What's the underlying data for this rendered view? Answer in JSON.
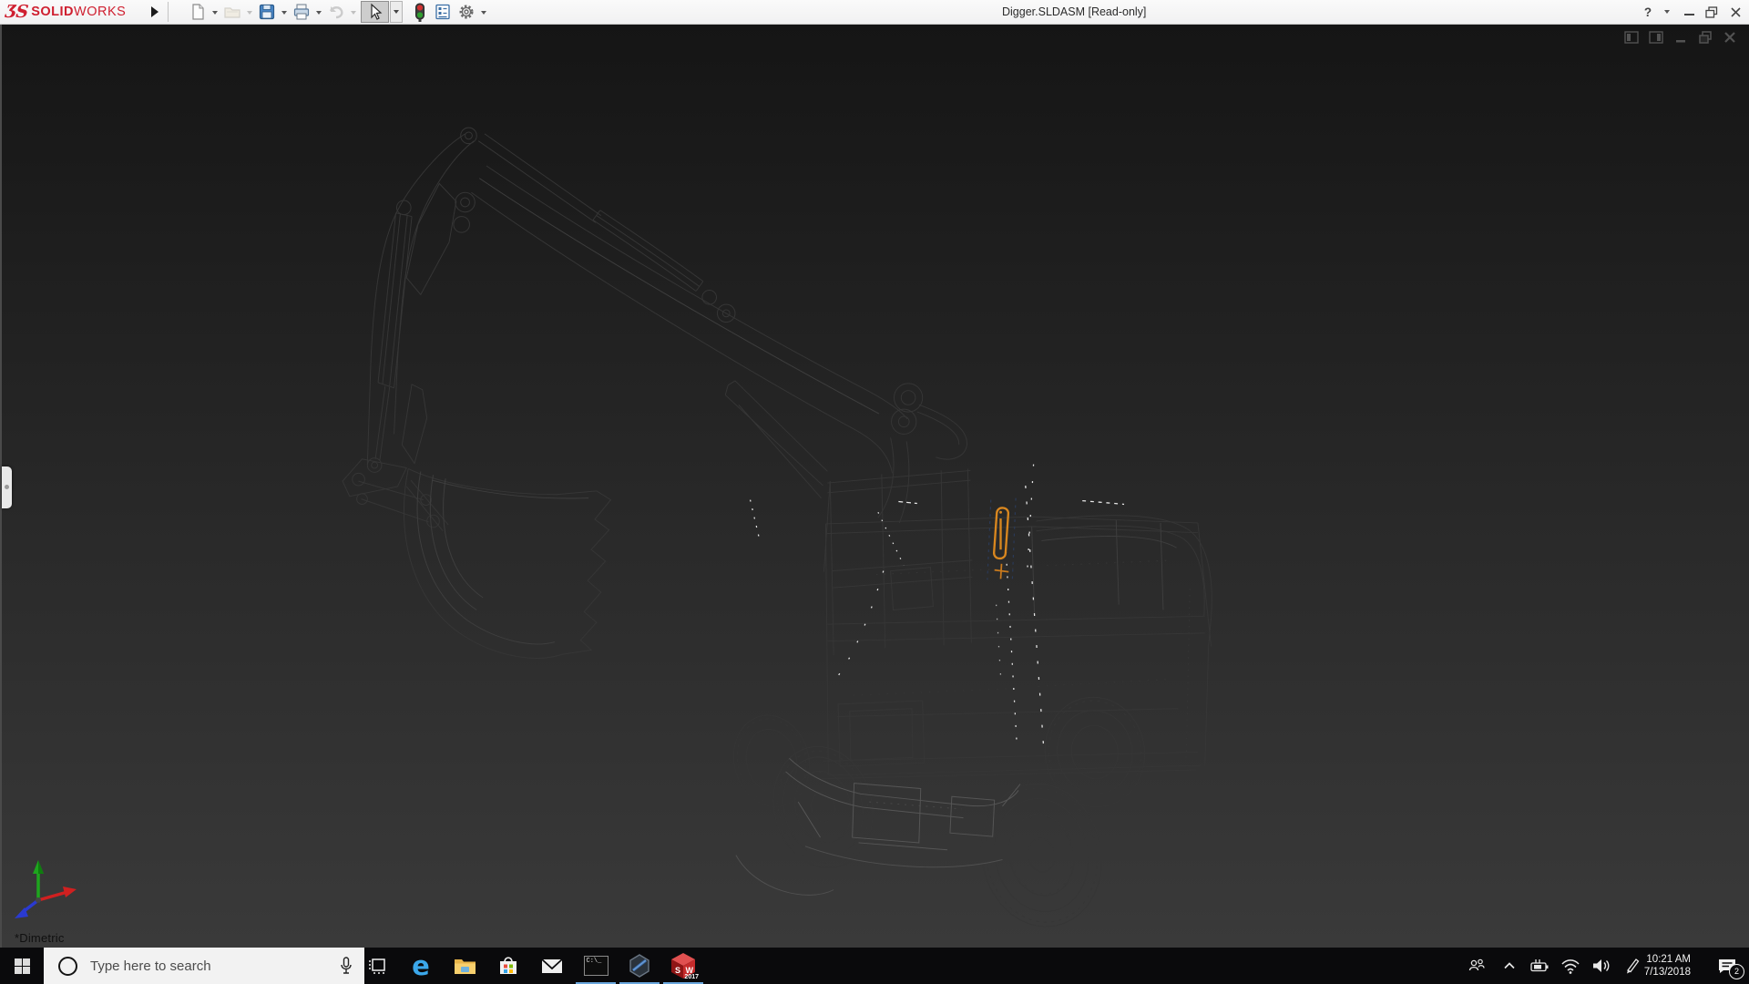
{
  "window": {
    "document_title": "Digger.SLDASM [Read-only]",
    "help_glyph": "?",
    "controls": [
      "help",
      "minimize",
      "restore",
      "close"
    ]
  },
  "titlebar": {
    "logo_mark": "ƷS",
    "brand_bold": "SOLID",
    "brand_light": "WORKS",
    "logo_color": "#cf1f2f",
    "tools": [
      "new-document",
      "open",
      "save",
      "print",
      "undo",
      "select",
      "rebuild",
      "file-properties",
      "options"
    ],
    "disabled_tools": [
      "open",
      "undo"
    ],
    "active_tool": "select"
  },
  "viewport": {
    "orientation_label": "*Dimetric",
    "controls": [
      "display-pane-left",
      "display-pane-right",
      "minimize-document",
      "restore-document",
      "close-document"
    ],
    "model": "digger-wireframe-assembly",
    "selection_highlight_color": "#d9871f",
    "background_top": "#151515",
    "background_bottom": "#3a3a3a",
    "triad_axis_colors": {
      "x": "#d02020",
      "y": "#1ea51e",
      "z": "#2a3ad0"
    }
  },
  "taskbar": {
    "search_placeholder": "Type here to search",
    "apps": [
      "task-view",
      "edge",
      "file-explorer",
      "store",
      "mail",
      "command-prompt",
      "edrawings",
      "solidworks-2017"
    ],
    "running_apps": [
      "command-prompt",
      "edrawings",
      "solidworks-2017"
    ],
    "underline_color": "#6aa7dd",
    "edge_glyph": "e",
    "cmd_label": "C:\\_",
    "sw_year": "2017",
    "tray_icons": [
      "people",
      "chevron-up",
      "power",
      "wifi",
      "volume",
      "pen"
    ],
    "clock": {
      "time": "10:21 AM",
      "date": "7/13/2018"
    },
    "notification_badge": "2"
  }
}
